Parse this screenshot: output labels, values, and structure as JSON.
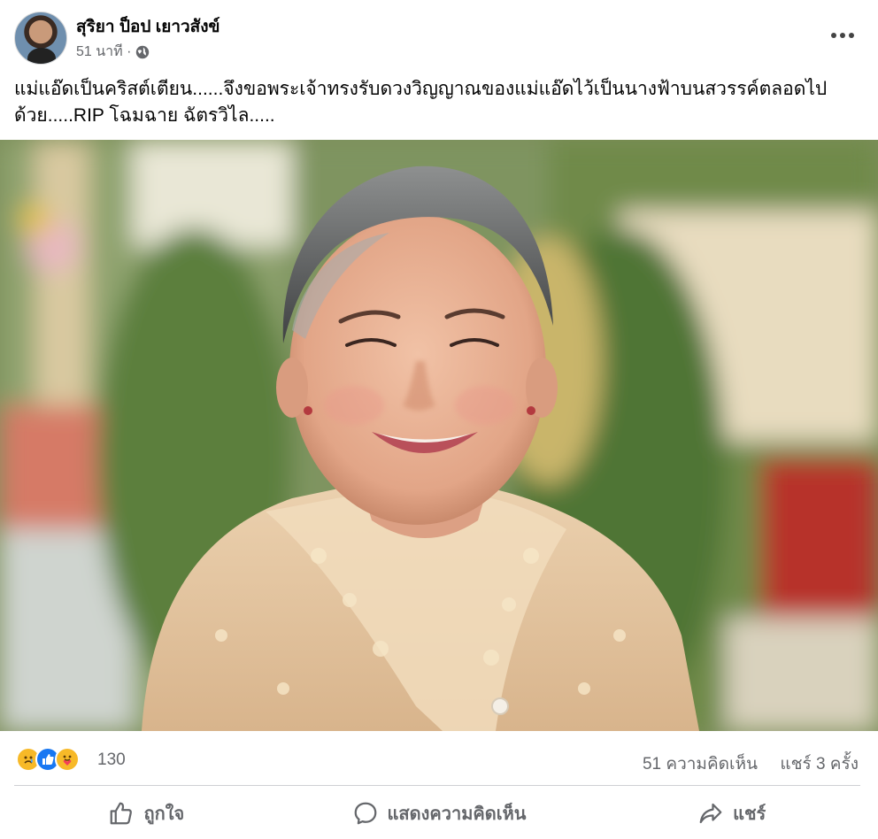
{
  "post": {
    "author": "สุริยา ป็อป เยาวสังข์",
    "time": "51 นาที ·",
    "privacy_icon": "globe-icon",
    "more_icon": "more-options-icon",
    "text": "แม่แอ๊ดเป็นคริสต์เตียน......จึงขอพระเจ้าทรงรับดวงวิญญาณของแม่แอ๊ดไว้เป็นนางฟ้าบนสวรรค์ตลอดไป\nด้วย.....RIP โฉมฉาย ฉัตรวิไล....."
  },
  "photo": {
    "subject": "portrait-photo"
  },
  "stats": {
    "reaction_icons": [
      "sad-reaction-icon",
      "like-reaction-icon",
      "care-reaction-icon"
    ],
    "reaction_count": "130",
    "comments": "51 ความคิดเห็น",
    "shares": "แชร์ 3 ครั้ง"
  },
  "actions": {
    "like": "ถูกใจ",
    "comment": "แสดงความคิดเห็น",
    "share": "แชร์"
  },
  "colors": {
    "secondary_text": "#65676b",
    "like_blue": "#1877f2",
    "divider": "#ced0d4"
  }
}
